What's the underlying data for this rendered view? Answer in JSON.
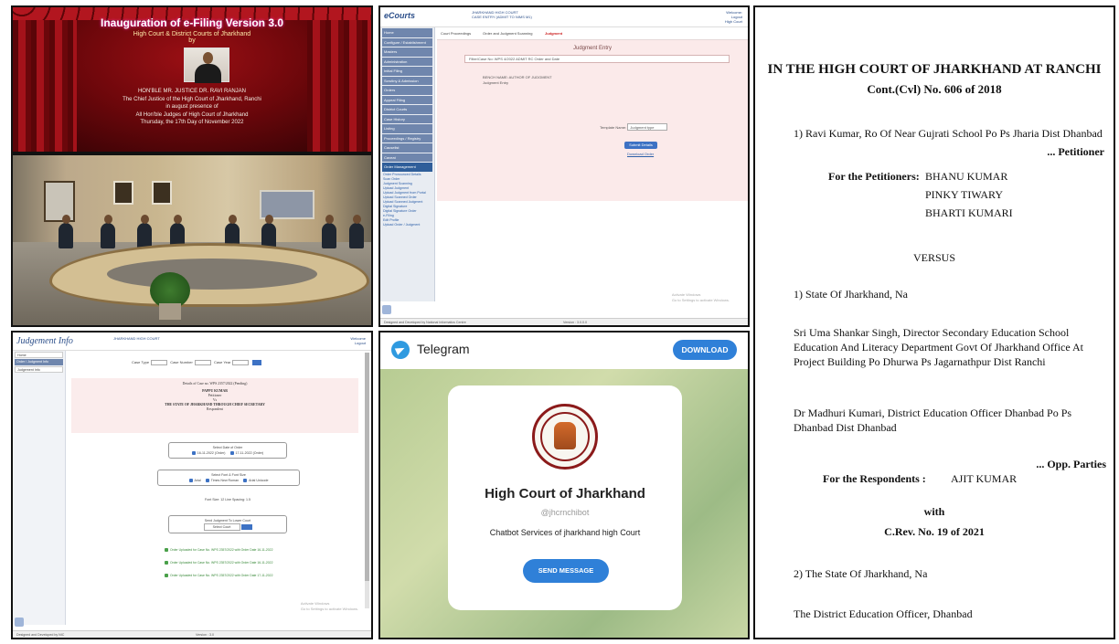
{
  "inauguration": {
    "title": "Inauguration of e-Filing Version 3.0",
    "subtitle": "High Court & District Courts of Jharkhand",
    "by": "by",
    "judge_name": "HON'BLE MR. JUSTICE DR. RAVI RANJAN",
    "judge_role": "The Chief Justice of the High Court of Jharkhand, Ranchi",
    "presence": "in august presence of",
    "others": "All Hon'ble Judges of High Court of Jharkhand",
    "date": "Thursday, the 17th Day of November 2022"
  },
  "ecourts": {
    "logo": "eCourts",
    "header_center": [
      "JHARKHAND HIGH COURT",
      "CASE ENTRY (ADMIT TO NIMS M1)"
    ],
    "header_right": [
      "Welcome: ",
      "Logout",
      "High Court"
    ],
    "toolbar_left": "Court Proceedings",
    "toolbar_mid": "Order and Judgment Scanning",
    "toolbar_tag": "Judgment",
    "page_heading": "Judgment Entry",
    "form_line": "Filter/Case No: WPS 4/2022 ADMIT RC Order and Date",
    "info_lines": [
      "BENCH NAME: AUTHOR OF JUDGMENT",
      "Judgment Entry"
    ],
    "select_label": "Template Name:",
    "select_value": "Judgment type",
    "submit_button": "Submit Details",
    "link": "Download Order",
    "sidebar": [
      "Home",
      "Configure / Establishment",
      "Masters",
      "Administration",
      "Initial Filing",
      "Scrutiny & Admission",
      "Orders",
      "Appeal Filing",
      "District Courts",
      "Case History",
      "Listing",
      "Proceedings / Registry",
      "Causelist",
      "Caveat",
      "Order Management"
    ],
    "sidebar_links": [
      "Order Pronounced Details",
      "Scan Order",
      "Judgment Scanning",
      "Upload Judgment",
      "Upload Judgment from Portal",
      "Upload Scanned Order",
      "Upload Scanned Judgment",
      "Digital Signature",
      "Digital Signature Order",
      "e-Filing",
      "Edit Profile",
      "Upload Order / Judgment"
    ],
    "footer_left": "Designed and Developed by National Informatics Centre",
    "footer_right": "Version : 3.0.0.0",
    "watermark": [
      "Activate Windows",
      "Go to Settings to activate Windows."
    ]
  },
  "judgement_info": {
    "logo": "Judgement Info",
    "header_center": "JHARKHAND HIGH COURT",
    "header_right": [
      "Welcome",
      "Logout"
    ],
    "sidebar": [
      "Home",
      "Order / Judgment Info",
      "Judgement Info"
    ],
    "filter_labels": [
      "Case Type",
      "Case Number",
      "Case Year",
      "Go"
    ],
    "case_title": "Details of Case no. WPS 2357/2022 (Pending)",
    "party1": "PAPPU KUMAR",
    "role1": "Petitioner",
    "versus": "Vs",
    "party2": "THE STATE OF JHARKHAND THROUGH CHIEF SECRETARY",
    "role2": "Respondent",
    "group1_title": "Select Date of Order",
    "group1_options": [
      "16-11-2022 (Order)",
      "17-11-2022 (Order)"
    ],
    "group2_title": "Select Font & Font Size",
    "group2_options": [
      "Arial",
      "Times New Roman",
      "Arial Unicode"
    ],
    "group3_line": "Font Size: 12   Line Spacing: 1.5",
    "group4_title": "Send Judgment To Lower Court",
    "group4_select": "Select Court",
    "green_lines": [
      "Order Uploaded for Case No. WPS 2357/2022 with Order Date 16-11-2022",
      "Order Uploaded for Case No. WPS 2357/2022 with Order Date 16-11-2022",
      "Order Uploaded for Case No. WPS 2357/2022 with Order Date 17-11-2022"
    ],
    "footer_left": "Designed and Developed by NIC",
    "footer_right": "Version : 3.0",
    "watermark": [
      "Activate Windows",
      "Go to Settings to activate Windows."
    ]
  },
  "telegram": {
    "app_name": "Telegram",
    "download_button": "DOWNLOAD",
    "seal_text": "HIGH COURT OF JHARKHAND · E-COURT PROJECT",
    "channel_title": "High Court of Jharkhand",
    "handle": "@jhcrnchibot",
    "description": "Chatbot Services of jharkhand high Court",
    "send_button": "SEND MESSAGE"
  },
  "document": {
    "court": "IN THE HIGH COURT OF JHARKHAND AT RANCHI",
    "case_no": "Cont.(Cvl) No. 606 of 2018",
    "petitioner_line": "1) Ravi Kumar, Ro Of Near Gujrati School Po Ps Jharia Dist Dhanbad",
    "petitioner_role": "... Petitioner",
    "for_petitioners_label": "For the Petitioners:",
    "counsel": [
      "BHANU KUMAR",
      "PINKY TIWARY",
      "BHARTI KUMARI"
    ],
    "versus": "VERSUS",
    "resp1": "1) State Of Jharkhand, Na",
    "resp2": "Sri Uma Shankar Singh, Director Secondary Education School Education And Literacy Department Govt Of Jharkhand Office At Project Building Po Dhurwa Ps Jagarnathpur Dist Ranchi",
    "resp3": "Dr Madhuri Kumari, District Education Officer Dhanbad Po Ps Dhanbad Dist Dhanbad",
    "resp_role": "... Opp. Parties",
    "for_respondents_label": "For the Respondents :",
    "resp_counsel": "AJIT KUMAR",
    "with": "with",
    "crev": "C.Rev. No. 19 of 2021",
    "resp4": "2) The State Of Jharkhand, Na",
    "resp5": "The District Education Officer, Dhanbad"
  }
}
